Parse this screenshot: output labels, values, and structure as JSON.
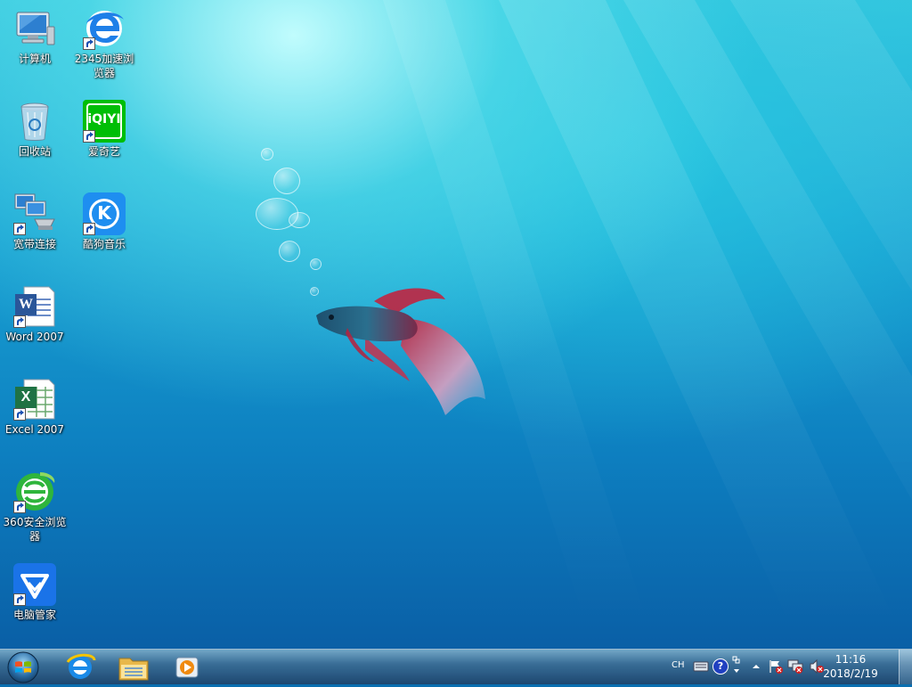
{
  "desktop": {
    "icons": [
      {
        "label": "计算机",
        "icon": "computer-icon"
      },
      {
        "label": "2345加速浏览器",
        "icon": "browser-2345-icon"
      },
      {
        "label": "回收站",
        "icon": "recycle-bin-icon"
      },
      {
        "label": "爱奇艺",
        "icon": "iqiyi-icon"
      },
      {
        "label": "宽带连接",
        "icon": "broadband-connection-icon"
      },
      {
        "label": "酷狗音乐",
        "icon": "kugou-music-icon"
      },
      {
        "label": "Word 2007",
        "icon": "word-icon"
      },
      {
        "label": "Excel 2007",
        "icon": "excel-icon"
      },
      {
        "label": "360安全浏览器",
        "icon": "browser-360-icon"
      },
      {
        "label": "电脑管家",
        "icon": "pc-manager-icon"
      }
    ],
    "iqiyi_logo": "iQIYI",
    "kugou_logo": "K",
    "word_logo": "W",
    "excel_logo": "X"
  },
  "taskbar": {
    "pinned": [
      {
        "icon": "internet-explorer-icon"
      },
      {
        "icon": "file-explorer-icon"
      },
      {
        "icon": "media-player-icon"
      }
    ],
    "tray": {
      "language": "CH",
      "help": "?"
    },
    "clock": {
      "time": "11:16",
      "date": "2018/2/19"
    }
  },
  "colors": {
    "iqiyi_green": "#00be06",
    "kugou_blue": "#1e8ef0",
    "pc_manager_blue": "#1a73e8",
    "browser_360_green": "#2fb53c",
    "word_blue": "#2a5699",
    "excel_green": "#1f7244"
  }
}
